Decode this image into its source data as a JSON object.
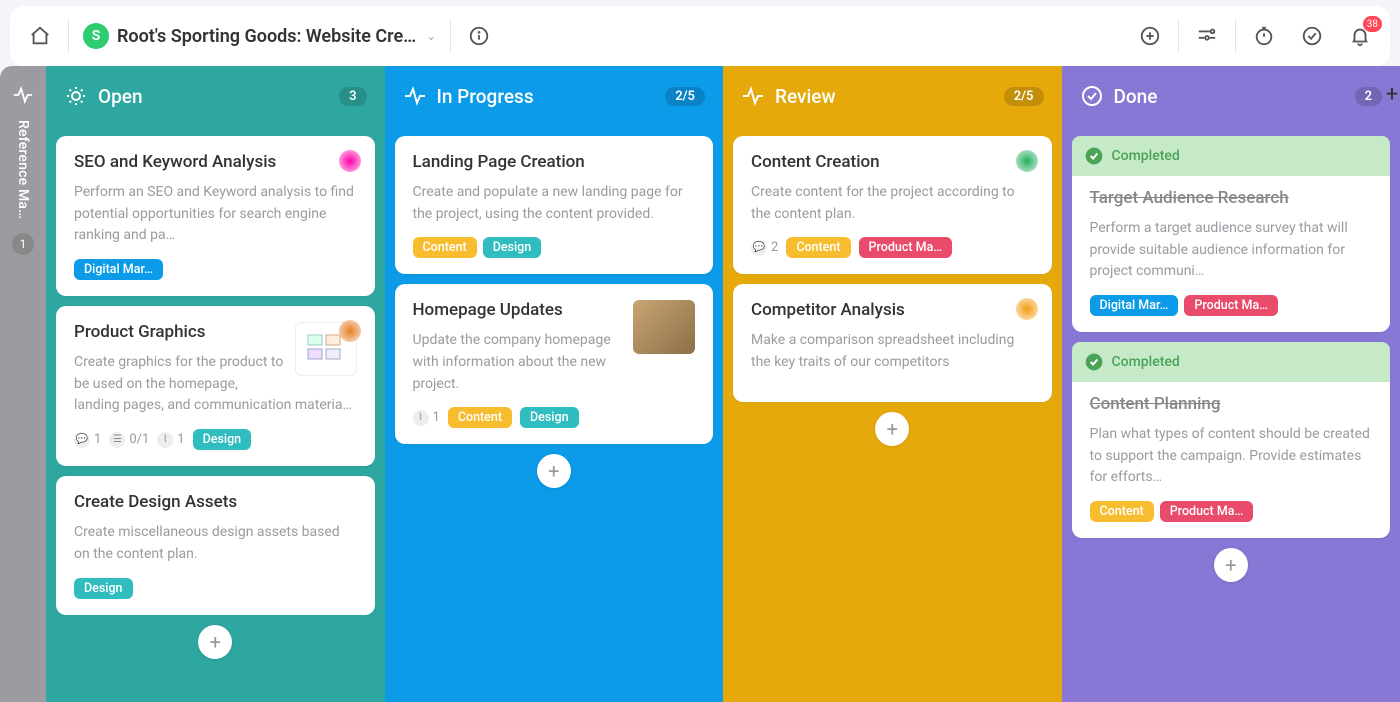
{
  "workspace": {
    "avatar_letter": "S",
    "title": "Root's Sporting Goods: Website Cre…",
    "notif_count": "38"
  },
  "sidebar": {
    "label": "Reference Ma…",
    "badge": "1"
  },
  "columns": [
    {
      "id": "open",
      "title": "Open",
      "count": "3",
      "cards": [
        {
          "title": "SEO and Keyword Analysis",
          "desc": "Perform an SEO and Keyword analysis to find potential opportunities for search engine ranking and pa…",
          "tags": [
            {
              "label": "Digital Mar…",
              "color": "blue"
            }
          ],
          "avatar_color": "#f0a"
        },
        {
          "title": "Product Graphics",
          "desc": "Create graphics for the product to be used on the homepage, landing pages, and communication materia…",
          "tags": [
            {
              "label": "Design",
              "color": "teal"
            }
          ],
          "meta": {
            "comments": "1",
            "subtasks": "0/1",
            "attachments": "1"
          },
          "avatar_color": "#e67e22",
          "has_thumb": true
        },
        {
          "title": "Create Design Assets",
          "desc": "Create miscellaneous design assets based on the content plan.",
          "tags": [
            {
              "label": "Design",
              "color": "teal"
            }
          ]
        }
      ]
    },
    {
      "id": "progress",
      "title": "In Progress",
      "count": "2/5",
      "cards": [
        {
          "title": "Landing Page Creation",
          "desc": "Create and populate a new landing page for the project, using the content provided.",
          "tags": [
            {
              "label": "Content",
              "color": "yellow"
            },
            {
              "label": "Design",
              "color": "teal"
            }
          ]
        },
        {
          "title": "Homepage Updates",
          "desc": "Update the company homepage with information about the new project.",
          "tags": [
            {
              "label": "Content",
              "color": "yellow"
            },
            {
              "label": "Design",
              "color": "teal"
            }
          ],
          "meta": {
            "attachments": "1"
          },
          "has_thumb": true
        }
      ]
    },
    {
      "id": "review",
      "title": "Review",
      "count": "2/5",
      "cards": [
        {
          "title": "Content Creation",
          "desc": "Create content for the project according to the content plan.",
          "tags": [
            {
              "label": "Content",
              "color": "yellow"
            },
            {
              "label": "Product Ma…",
              "color": "red"
            }
          ],
          "meta": {
            "comments": "2"
          },
          "avatar_color": "#27ae60"
        },
        {
          "title": "Competitor Analysis",
          "desc": "Make a comparison spreadsheet including the key traits of our competitors",
          "avatar_color": "#f39c12"
        }
      ]
    },
    {
      "id": "done",
      "title": "Done",
      "count": "2",
      "cards": [
        {
          "completed": true,
          "completed_label": "Completed",
          "title": "Target Audience Research",
          "desc": "Perform a target audience survey that will provide suitable audience information for project communi…",
          "tags": [
            {
              "label": "Digital Mar…",
              "color": "blue"
            },
            {
              "label": "Product Ma…",
              "color": "red"
            }
          ]
        },
        {
          "completed": true,
          "completed_label": "Completed",
          "title": "Content Planning",
          "desc": "Plan what types of content should be created to support the campaign. Provide estimates for efforts…",
          "tags": [
            {
              "label": "Content",
              "color": "yellow"
            },
            {
              "label": "Product Ma…",
              "color": "red"
            }
          ]
        }
      ]
    }
  ]
}
